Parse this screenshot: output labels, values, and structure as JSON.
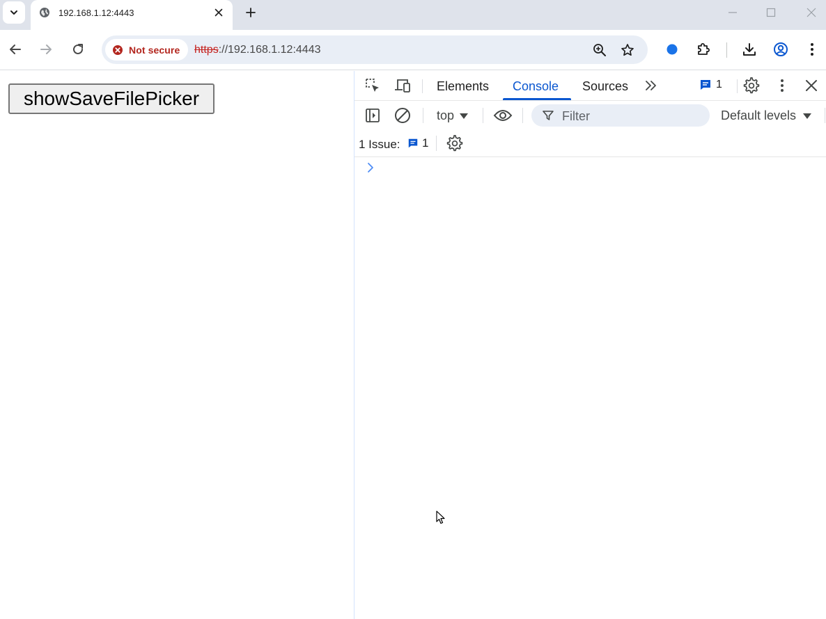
{
  "tab": {
    "title": "192.168.1.12:4443"
  },
  "toolbar": {
    "security_chip_label": "Not secure",
    "url_scheme": "https",
    "url_rest": "://192.168.1.12:4443"
  },
  "page": {
    "button_label": "showSaveFilePicker"
  },
  "devtools": {
    "tabs": [
      "Elements",
      "Console",
      "Sources"
    ],
    "active_tab": "Console",
    "issue_badge_count": "1",
    "context_select": "top",
    "filter_placeholder": "Filter",
    "log_levels": "Default levels",
    "issues_label": "1 Issue:",
    "issues_count": "1"
  },
  "colors": {
    "accent": "#0b57d0",
    "not_secure": "#b3261e",
    "tabstrip": "#dfe3eb",
    "omnibox": "#e9eef6"
  },
  "icons": {
    "tabstrip": [
      "tab-search-chevron-icon",
      "globe-icon",
      "close-icon",
      "plus-icon",
      "minimize-icon",
      "maximize-icon",
      "close-window-icon"
    ],
    "toolbar": [
      "back-arrow-icon",
      "forward-arrow-icon",
      "reload-icon",
      "not-secure-icon",
      "zoom-icon",
      "star-icon",
      "extension-dot-icon",
      "puzzle-icon",
      "download-icon",
      "profile-icon",
      "kebab-menu-icon"
    ],
    "devtools": [
      "inspect-element-icon",
      "device-toolbar-icon",
      "more-tabs-icon",
      "issues-message-icon",
      "settings-gear-icon",
      "kebab-menu-icon",
      "close-icon",
      "sidebar-toggle-icon",
      "clear-console-icon",
      "dropdown-caret-icon",
      "eye-icon",
      "filter-funnel-icon",
      "console-prompt-chevron-icon"
    ]
  }
}
